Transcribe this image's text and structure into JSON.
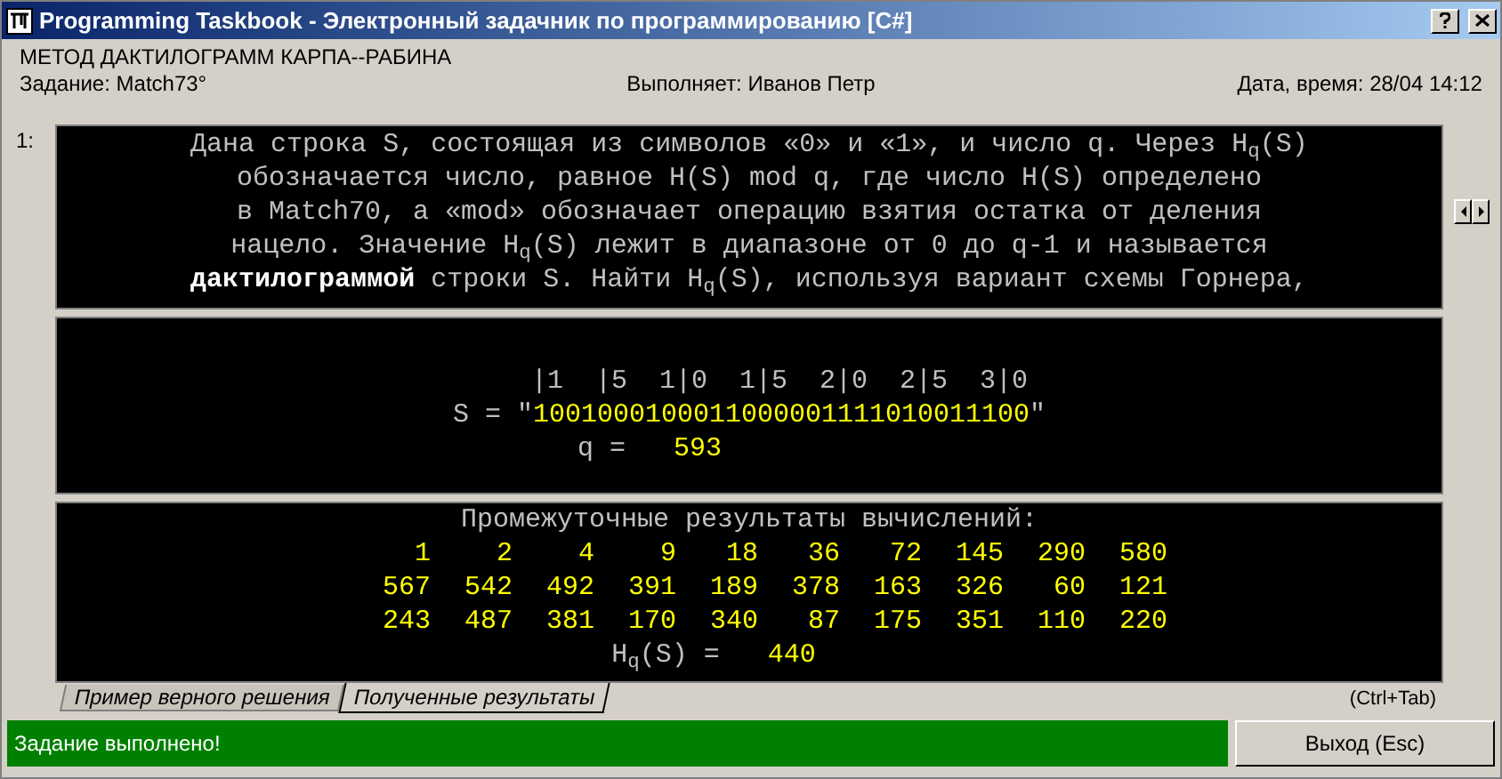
{
  "window": {
    "title": "Programming Taskbook - Электронный задачник по программированию [C#]"
  },
  "header": {
    "topic": "МЕТОД ДАКТИЛОГРАММ КАРПА--РАБИНА",
    "task": "Задание: Match73°",
    "performer": "Выполняет: Иванов Петр",
    "datetime": "Дата, время: 28/04 14:12"
  },
  "task_panel": {
    "number": "1:",
    "lines": [
      "Дана строка S, состоящая из символов «0» и «1», и число q. Через H$_{q}$(S)",
      "обозначается число, равное H(S) mod q, где число H(S) определено",
      "в Match70, а «mod» обозначает операцию взятия остатка от деления",
      "нацело. Значение H$_{q}$(S) лежит в диапазоне от 0 до q-1 и называется",
      "**дактилограммой** строки S. Найти H$_{q}$(S), используя вариант схемы Горнера,"
    ]
  },
  "input_panel": {
    "ruler": "|1  |5  1|0  1|5  2|0  2|5  3|0",
    "s_label": "S =",
    "s_value": "\"1001000100011000001111010011100\"",
    "q_label": "q =",
    "q_value": "593"
  },
  "results_panel": {
    "title": "Промежуточные результаты вычислений:",
    "rows": [
      [
        "1",
        "2",
        "4",
        "9",
        "18",
        "36",
        "72",
        "145",
        "290",
        "580"
      ],
      [
        "567",
        "542",
        "492",
        "391",
        "189",
        "378",
        "163",
        "326",
        "60",
        "121"
      ],
      [
        "243",
        "487",
        "381",
        "170",
        "340",
        "87",
        "175",
        "351",
        "110",
        "220"
      ]
    ],
    "result_label": "H$_{q}$(S) =",
    "result_value": "440"
  },
  "tabs": [
    {
      "label": "Пример верного решения",
      "selected": false
    },
    {
      "label": "Полученные результаты",
      "selected": true
    }
  ],
  "tab_hint": "(Ctrl+Tab)",
  "status_bar": {
    "message": "Задание выполнено!",
    "exit_button": "Выход (Esc)"
  }
}
